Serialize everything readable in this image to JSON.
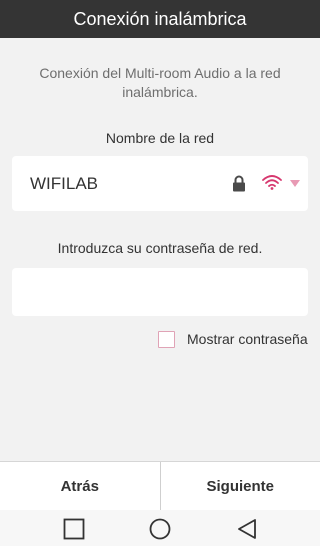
{
  "header": {
    "title": "Conexión inalámbrica"
  },
  "description": "Conexión del Multi-room Audio a la red inalámbrica.",
  "network": {
    "label": "Nombre de la red",
    "selected": "WIFILAB",
    "icons": [
      "lock-icon",
      "wifi-icon",
      "dropdown-arrow-icon"
    ]
  },
  "password": {
    "label": "Introduzca su contraseña de red.",
    "value": "",
    "placeholder": ""
  },
  "show_password": {
    "label": "Mostrar contraseña",
    "checked": false
  },
  "footer": {
    "back_label": "Atrás",
    "next_label": "Siguiente"
  },
  "system_nav": {
    "icons": [
      "recent-apps-icon",
      "home-icon",
      "back-icon"
    ]
  },
  "colors": {
    "header_bg": "#343434",
    "accent": "#d6376e",
    "checkbox_border": "#e0a3b6",
    "background": "#f2f2f2"
  }
}
